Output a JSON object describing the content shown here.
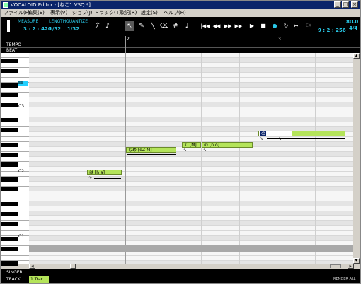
{
  "window": {
    "title": "VOCALOID Editor - [ねこ1.VSQ *]",
    "buttons": [
      "_",
      "□",
      "×"
    ]
  },
  "menu": [
    "ファイル(F)",
    "編集(E)",
    "表示(V)",
    "ジョブ(J)",
    "トラック(T)",
    "歌詞(R)",
    "設定(S)",
    "ヘルプ(H)"
  ],
  "toolbar": {
    "measure_label": "MEASURE",
    "measure_value": "3 : 2 : 420",
    "length_label": "LENGTH",
    "length_value": "1/32",
    "quantize_label": "QUANTIZE",
    "quantize_value": "1/32",
    "tools": [
      "⤴",
      "♪",
      "↖",
      "✎",
      "╲",
      "⌫",
      "#",
      "♩"
    ],
    "transport": [
      "|◀◀",
      "◀◀",
      "▶▶",
      "▶▶|",
      "▶",
      "■",
      "●",
      "↻",
      "↔",
      "EX"
    ],
    "tempo_value": "80.0",
    "beat_value": "4/4",
    "time_value": "9 : 2 : 256"
  },
  "rulers": {
    "tempo_label": "TEMPO",
    "beat_label": "BEAT",
    "bars": [
      "2",
      "3"
    ]
  },
  "keyboard": {
    "labels": [
      "C3",
      "C2",
      "C1"
    ],
    "cursor_key": "E3"
  },
  "notes": [
    {
      "lyric": "は [h a]"
    },
    {
      "lyric": "じめ [dZ M]"
    },
    {
      "lyric": "て [M]"
    },
    {
      "lyric": "の [n o]"
    },
    {
      "lyric": "の"
    }
  ],
  "bottom": {
    "singer_label": "SINGER",
    "track_label": "TRACK",
    "track_tab": "1 Trac",
    "render_all": "RENDER ALL"
  },
  "colors": {
    "note_fill": "#b4e45a",
    "cursor_key": "#22d0ff",
    "toolbar_text": "#29c7e6"
  }
}
